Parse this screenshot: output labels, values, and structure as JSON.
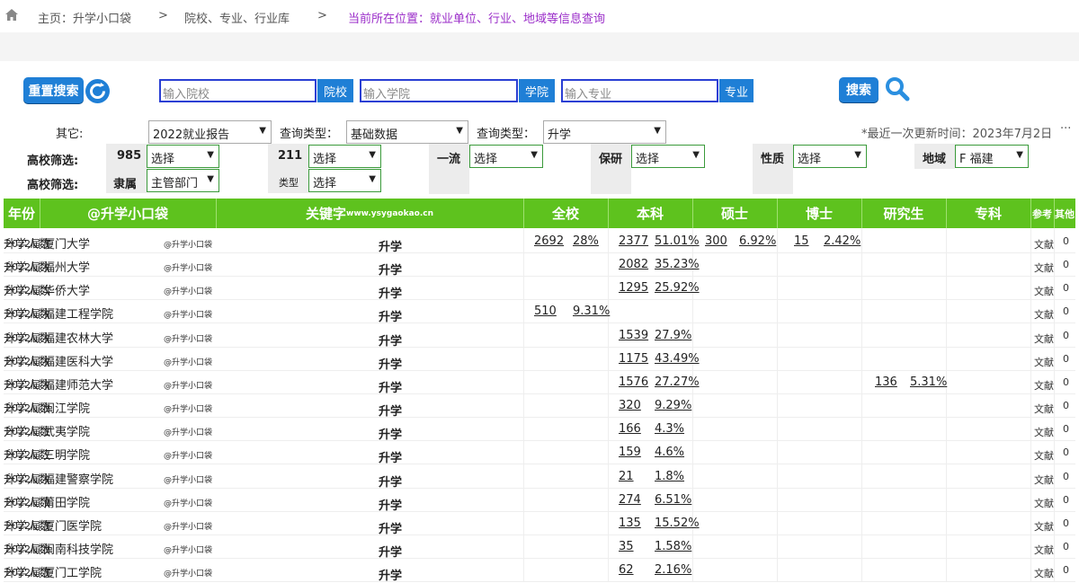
{
  "breadcrumb": {
    "home": "主页：升学小口袋",
    "sep1": ">",
    "library": "院校、专业、行业库",
    "sep2": ">",
    "current": "当前所在位置：就业单位、行业、地域等信息查询"
  },
  "search": {
    "reset_label": "重置搜索",
    "school_placeholder": "输入院校",
    "school_tag": "院校",
    "college_placeholder": "输入学院",
    "college_tag": "学院",
    "major_placeholder": "输入专业",
    "major_tag": "专业",
    "search_label": "搜索"
  },
  "filters": {
    "other_label": "其它:",
    "report_value": "2022就业报告",
    "query_type_label1": "查询类型：",
    "query_type_value1": "基础数据",
    "query_type_label2": "查询类型：",
    "query_type_value2": "升学",
    "updated": "*最近一次更新时间：2023年7月2日",
    "more": "···",
    "screen_label1": "高校筛选:",
    "screen_label2": "高校筛选:",
    "f985_label": "985",
    "f985_value": "选择",
    "f211_label": "211",
    "f211_value": "选择",
    "first_class_label": "一流",
    "first_class_value": "选择",
    "postgrad_label": "保研",
    "postgrad_value": "选择",
    "nature_label": "性质",
    "nature_value": "选择",
    "region_label": "地域",
    "region_value": "F 福建",
    "affiliation_label": "隶属",
    "affiliation_value": "主管部门",
    "type_label": "类型",
    "type_value": "选择"
  },
  "table": {
    "headers": {
      "year": "年份",
      "brand": "@升学小口袋",
      "keyword": "关键字",
      "keyword_site": "www.ysygaokao.cn",
      "all": "全校",
      "bachelor": "本科",
      "master": "硕士",
      "phd": "博士",
      "postgrad": "研究生",
      "junior": "专科",
      "ref": "参考",
      "other": "其他"
    },
    "rows": [
      {
        "year": "2022届",
        "school": "厦门大学",
        "tag": "@升学小口袋",
        "kwlabel": "升学人数",
        "kw": "升学",
        "all_n": "2692",
        "all_p": "28%",
        "bach_n": "2377",
        "bach_p": "51.01%",
        "mas_n": "300",
        "mas_p": "6.92%",
        "phd_n": "15",
        "phd_p": "2.42%",
        "pg_n": "",
        "pg_p": "",
        "ref": "文献",
        "oth": "0"
      },
      {
        "year": "2022届",
        "school": "福州大学",
        "tag": "@升学小口袋",
        "kwlabel": "升学人数",
        "kw": "升学",
        "all_n": "",
        "all_p": "",
        "bach_n": "2082",
        "bach_p": "35.23%",
        "mas_n": "",
        "mas_p": "",
        "phd_n": "",
        "phd_p": "",
        "pg_n": "",
        "pg_p": "",
        "ref": "文献",
        "oth": "0"
      },
      {
        "year": "2022届",
        "school": "华侨大学",
        "tag": "@升学小口袋",
        "kwlabel": "升学人数",
        "kw": "升学",
        "all_n": "",
        "all_p": "",
        "bach_n": "1295",
        "bach_p": "25.92%",
        "mas_n": "",
        "mas_p": "",
        "phd_n": "",
        "phd_p": "",
        "pg_n": "",
        "pg_p": "",
        "ref": "文献",
        "oth": "0"
      },
      {
        "year": "2022届",
        "school": "福建工程学院",
        "tag": "@升学小口袋",
        "kwlabel": "升学人数",
        "kw": "升学",
        "all_n": "510",
        "all_p": "9.31%",
        "bach_n": "",
        "bach_p": "",
        "mas_n": "",
        "mas_p": "",
        "phd_n": "",
        "phd_p": "",
        "pg_n": "",
        "pg_p": "",
        "ref": "文献",
        "oth": "0"
      },
      {
        "year": "2022届",
        "school": "福建农林大学",
        "tag": "@升学小口袋",
        "kwlabel": "升学人数",
        "kw": "升学",
        "all_n": "",
        "all_p": "",
        "bach_n": "1539",
        "bach_p": "27.9%",
        "mas_n": "",
        "mas_p": "",
        "phd_n": "",
        "phd_p": "",
        "pg_n": "",
        "pg_p": "",
        "ref": "文献",
        "oth": "0"
      },
      {
        "year": "2022届",
        "school": "福建医科大学",
        "tag": "@升学小口袋",
        "kwlabel": "升学人数",
        "kw": "升学",
        "all_n": "",
        "all_p": "",
        "bach_n": "1175",
        "bach_p": "43.49%",
        "mas_n": "",
        "mas_p": "",
        "phd_n": "",
        "phd_p": "",
        "pg_n": "",
        "pg_p": "",
        "ref": "文献",
        "oth": "0"
      },
      {
        "year": "2022届",
        "school": "福建师范大学",
        "tag": "@升学小口袋",
        "kwlabel": "升学人数",
        "kw": "升学",
        "all_n": "",
        "all_p": "",
        "bach_n": "1576",
        "bach_p": "27.27%",
        "mas_n": "",
        "mas_p": "",
        "phd_n": "",
        "phd_p": "",
        "pg_n": "136",
        "pg_p": "5.31%",
        "ref": "文献",
        "oth": "0"
      },
      {
        "year": "2022届",
        "school": "闽江学院",
        "tag": "@升学小口袋",
        "kwlabel": "升学人数",
        "kw": "升学",
        "all_n": "",
        "all_p": "",
        "bach_n": "320",
        "bach_p": "9.29%",
        "mas_n": "",
        "mas_p": "",
        "phd_n": "",
        "phd_p": "",
        "pg_n": "",
        "pg_p": "",
        "ref": "文献",
        "oth": "0"
      },
      {
        "year": "2022届",
        "school": "武夷学院",
        "tag": "@升学小口袋",
        "kwlabel": "升学人数",
        "kw": "升学",
        "all_n": "",
        "all_p": "",
        "bach_n": "166",
        "bach_p": "4.3%",
        "mas_n": "",
        "mas_p": "",
        "phd_n": "",
        "phd_p": "",
        "pg_n": "",
        "pg_p": "",
        "ref": "文献",
        "oth": "0"
      },
      {
        "year": "2022届",
        "school": "三明学院",
        "tag": "@升学小口袋",
        "kwlabel": "升学人数",
        "kw": "升学",
        "all_n": "",
        "all_p": "",
        "bach_n": "159",
        "bach_p": "4.6%",
        "mas_n": "",
        "mas_p": "",
        "phd_n": "",
        "phd_p": "",
        "pg_n": "",
        "pg_p": "",
        "ref": "文献",
        "oth": "0"
      },
      {
        "year": "2022届",
        "school": "福建警察学院",
        "tag": "@升学小口袋",
        "kwlabel": "升学人数",
        "kw": "升学",
        "all_n": "",
        "all_p": "",
        "bach_n": "21",
        "bach_p": "1.8%",
        "mas_n": "",
        "mas_p": "",
        "phd_n": "",
        "phd_p": "",
        "pg_n": "",
        "pg_p": "",
        "ref": "文献",
        "oth": "0"
      },
      {
        "year": "2022届",
        "school": "莆田学院",
        "tag": "@升学小口袋",
        "kwlabel": "升学人数",
        "kw": "升学",
        "all_n": "",
        "all_p": "",
        "bach_n": "274",
        "bach_p": "6.51%",
        "mas_n": "",
        "mas_p": "",
        "phd_n": "",
        "phd_p": "",
        "pg_n": "",
        "pg_p": "",
        "ref": "文献",
        "oth": "0"
      },
      {
        "year": "2022届",
        "school": "厦门医学院",
        "tag": "@升学小口袋",
        "kwlabel": "升学人数",
        "kw": "升学",
        "all_n": "",
        "all_p": "",
        "bach_n": "135",
        "bach_p": "15.52%",
        "mas_n": "",
        "mas_p": "",
        "phd_n": "",
        "phd_p": "",
        "pg_n": "",
        "pg_p": "",
        "ref": "文献",
        "oth": "0"
      },
      {
        "year": "2022届",
        "school": "闽南科技学院",
        "tag": "@升学小口袋",
        "kwlabel": "升学人数",
        "kw": "升学",
        "all_n": "",
        "all_p": "",
        "bach_n": "35",
        "bach_p": "1.58%",
        "mas_n": "",
        "mas_p": "",
        "phd_n": "",
        "phd_p": "",
        "pg_n": "",
        "pg_p": "",
        "ref": "文献",
        "oth": "0"
      },
      {
        "year": "2022届",
        "school": "厦门工学院",
        "tag": "@升学小口袋",
        "kwlabel": "升学人数",
        "kw": "升学",
        "all_n": "",
        "all_p": "",
        "bach_n": "62",
        "bach_p": "2.16%",
        "mas_n": "",
        "mas_p": "",
        "phd_n": "",
        "phd_p": "",
        "pg_n": "",
        "pg_p": "",
        "ref": "文献",
        "oth": "0"
      }
    ]
  },
  "colors": {
    "header_green": "#5ec21e",
    "accent_blue": "#1f7fd6",
    "breadcrumb_purple": "#9b2ec9"
  }
}
